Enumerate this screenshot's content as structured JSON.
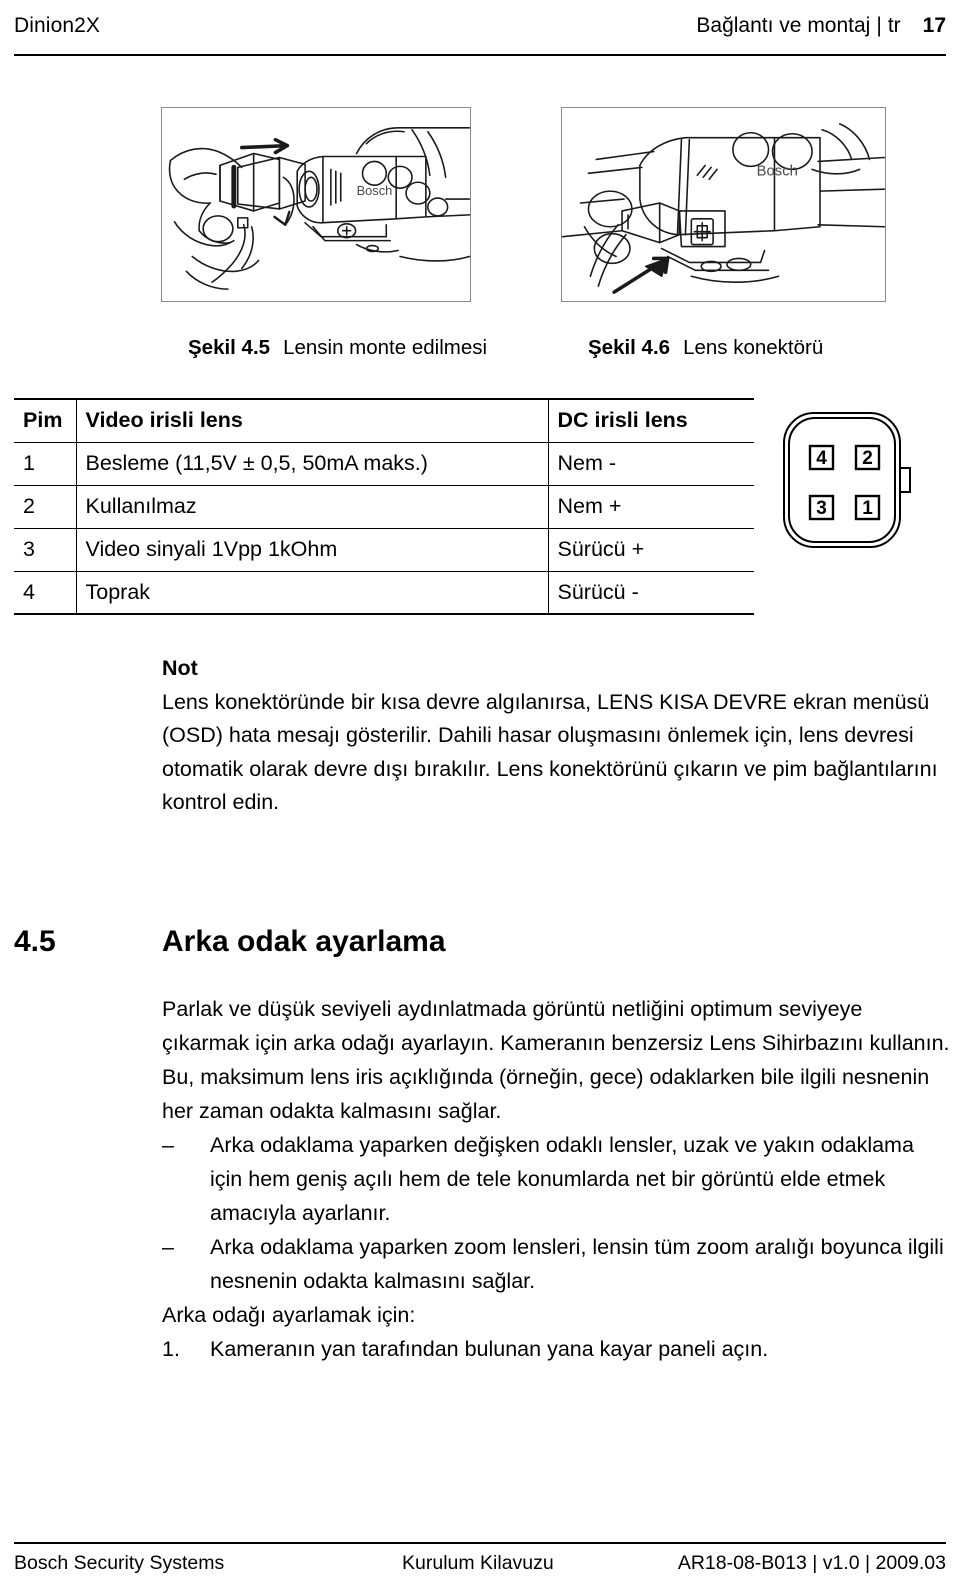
{
  "header": {
    "product": "Dinion2X",
    "chapter": "Bağlantı ve montaj",
    "separator": "|",
    "language": "tr",
    "page_number": "17"
  },
  "figures": [
    {
      "id": "figure-lens-mounting",
      "caption_number": "Şekil 4.5",
      "caption_text": "Lensin monte edilmesi",
      "alt": "Hands mounting a lens onto a Bosch camera body",
      "brand_label": "Bosch"
    },
    {
      "id": "figure-lens-connector",
      "caption_number": "Şekil 4.6",
      "caption_text": "Lens konektörü",
      "alt": "Close-up of the lens connector being plugged into the camera",
      "brand_label": "Bosch"
    }
  ],
  "pin_table": {
    "headers": [
      "Pim",
      "Video irisli lens",
      "DC irisli lens"
    ],
    "rows": [
      [
        "1",
        "Besleme (11,5V ± 0,5, 50mA maks.)",
        "Nem -"
      ],
      [
        "2",
        "Kullanılmaz",
        "Nem +"
      ],
      [
        "3",
        "Video sinyali 1Vpp 1kOhm",
        "Sürücü +"
      ],
      [
        "4",
        "Toprak",
        "Sürücü -"
      ]
    ]
  },
  "connector_diagram": {
    "name": "4-pin lens connector pinout",
    "pins": {
      "top_left": "4",
      "top_right": "2",
      "bottom_left": "3",
      "bottom_right": "1"
    }
  },
  "note": {
    "title": "Not",
    "body": "Lens konektöründe bir kısa devre algılanırsa, LENS KISA DEVRE ekran menüsü (OSD) hata mesajı gösterilir. Dahili hasar oluşmasını önlemek için, lens devresi otomatik olarak devre dışı bırakılır. Lens konektörünü çıkarın ve pim bağlantılarını kontrol edin."
  },
  "section": {
    "number": "4.5",
    "title": "Arka odak ayarlama",
    "paragraph": "Parlak ve düşük seviyeli aydınlatmada görüntü netliğini optimum seviyeye çıkarmak için arka odağı ayarlayın. Kameranın benzersiz Lens Sihirbazını kullanın. Bu, maksimum lens iris açıklığında (örneğin, gece) odaklarken bile ilgili nesnenin her zaman odakta kalmasını sağlar.",
    "bullet_mark": "–",
    "bullets": [
      "Arka odaklama yaparken değişken odaklı lensler, uzak ve yakın odaklama için hem geniş açılı hem de tele konumlarda net bir görüntü elde etmek amacıyla ayarlanır.",
      "Arka odaklama yaparken zoom lensleri, lensin tüm zoom aralığı boyunca ilgili nesnenin odakta kalmasını sağlar."
    ],
    "steps_intro": "Arka odağı ayarlamak için:",
    "steps": [
      {
        "mark": "1.",
        "text": "Kameranın yan tarafından bulunan yana kayar paneli açın."
      }
    ]
  },
  "footer": {
    "left": "Bosch Security Systems",
    "center": "Kurulum Kilavuzu",
    "right": "AR18-08-B013 | v1.0 | 2009.03"
  },
  "colors": {
    "text": "#000000",
    "rule": "#000000",
    "figure_border": "#8a8a8a",
    "page_background": "#ffffff"
  }
}
